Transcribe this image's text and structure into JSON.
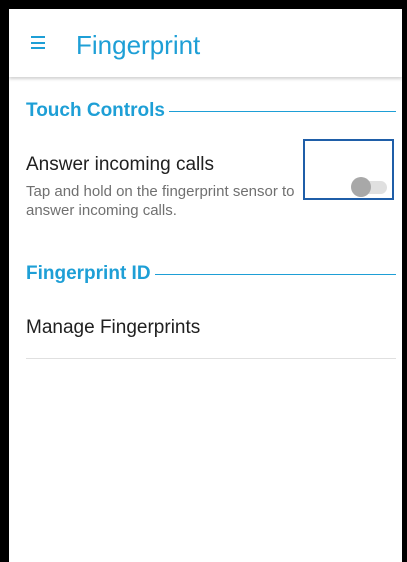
{
  "app_bar": {
    "menu_icon": "hamburger-menu-icon",
    "title": "Fingerprint"
  },
  "sections": {
    "touch_controls": {
      "header": "Touch Controls",
      "answer_calls": {
        "title": "Answer incoming calls",
        "summary": "Tap and hold on the fingerprint sensor to answer incoming calls.",
        "toggle_state": "off"
      }
    },
    "fingerprint_id": {
      "header": "Fingerprint ID",
      "manage": {
        "title": "Manage Fingerprints"
      }
    }
  },
  "colors": {
    "accent": "#1e9fd6",
    "highlight_box": "#1f5ea8",
    "toggle_thumb_off": "#a8a8a8",
    "toggle_track_off": "#e0e0e0"
  }
}
